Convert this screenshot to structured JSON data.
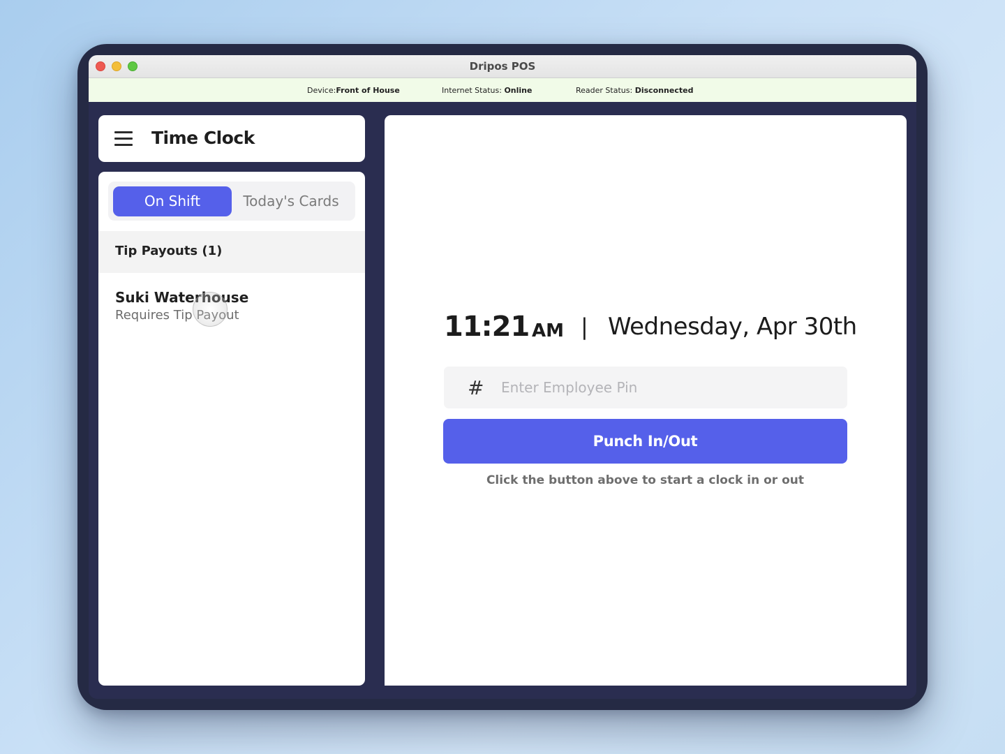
{
  "window": {
    "title": "Dripos POS"
  },
  "status_bar": {
    "device_label": "Device:",
    "device_value": "Front of House",
    "internet_label": "Internet Status:",
    "internet_value": "Online",
    "reader_label": "Reader Status:",
    "reader_value": "Disconnected"
  },
  "header": {
    "menu_icon": "hamburger-icon",
    "title": "Time Clock"
  },
  "tabs": [
    {
      "label": "On Shift",
      "active": true
    },
    {
      "label": "Today's Cards",
      "active": false
    }
  ],
  "tip_payouts": {
    "section_title": "Tip Payouts (1)",
    "items": [
      {
        "name": "Suki Waterhouse",
        "status": "Requires Tip Payout"
      }
    ]
  },
  "clock": {
    "time": "11:21",
    "ampm": "AM",
    "separator": "|",
    "date": "Wednesday, Apr 30th"
  },
  "pin_field": {
    "icon": "hash-icon",
    "icon_glyph": "#",
    "placeholder": "Enter Employee Pin",
    "value": ""
  },
  "punch_button": {
    "label": "Punch In/Out"
  },
  "helper_text": "Click the button above to start a clock in or out",
  "colors": {
    "accent": "#5560ea",
    "frame": "#2a2d50",
    "status_bar_bg": "#f1fbe8"
  }
}
